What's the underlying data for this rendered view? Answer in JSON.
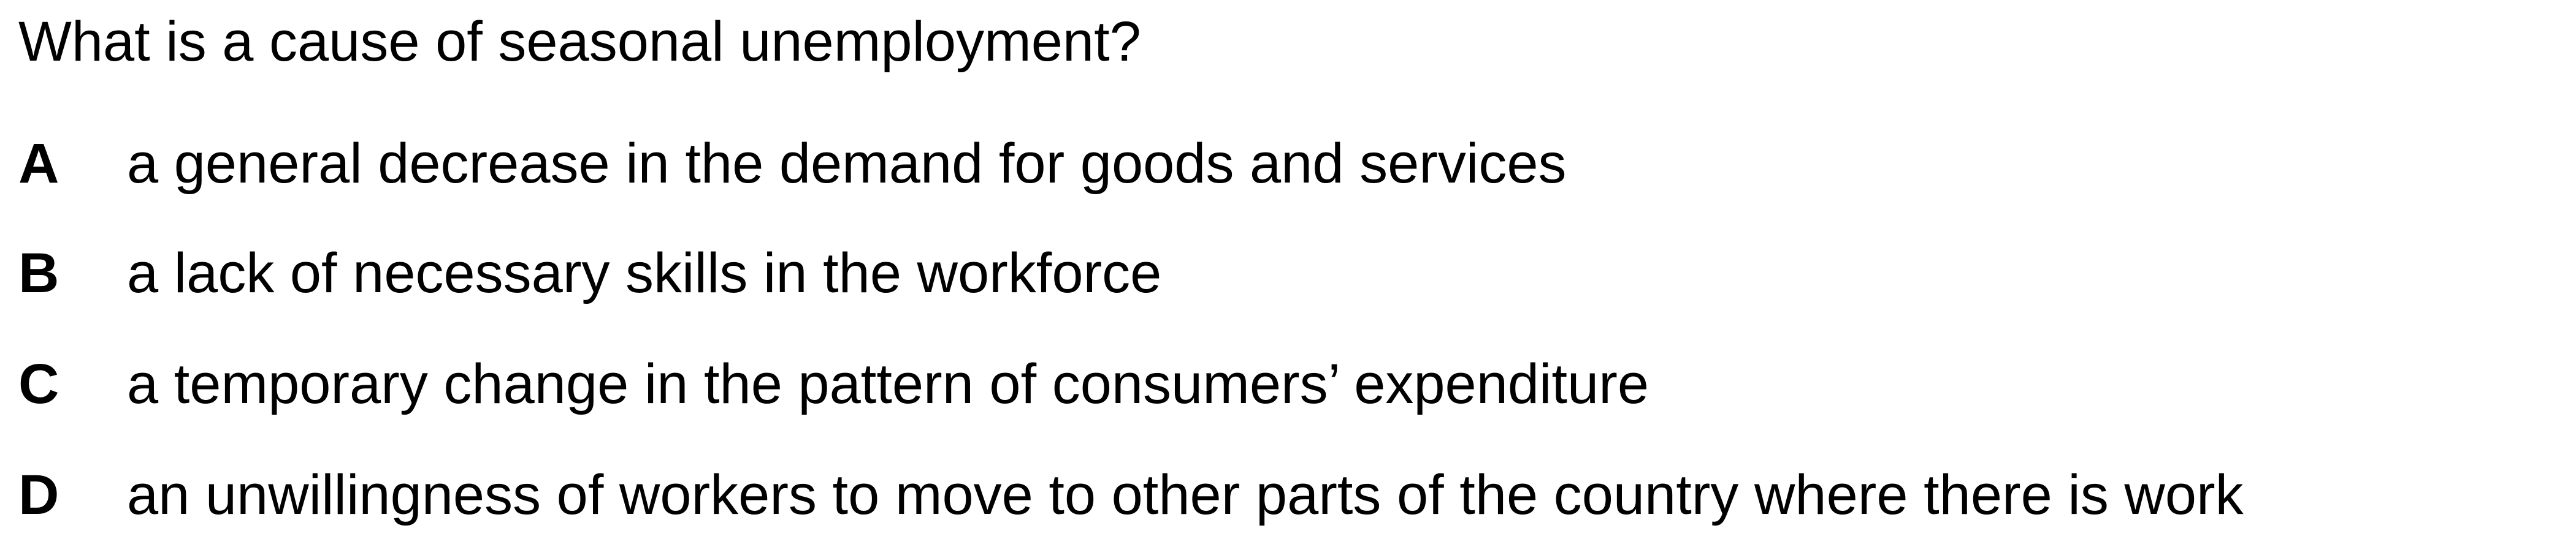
{
  "question": {
    "text": "What is a cause of seasonal unemployment?"
  },
  "options": [
    {
      "letter": "A",
      "text": "a general decrease in the demand for goods and services"
    },
    {
      "letter": "B",
      "text": "a lack of necessary skills in the workforce"
    },
    {
      "letter": "C",
      "text": "a temporary change in the pattern of consumers’ expenditure"
    },
    {
      "letter": "D",
      "text": "an unwillingness of workers to move to other parts of the country where there is work"
    }
  ]
}
